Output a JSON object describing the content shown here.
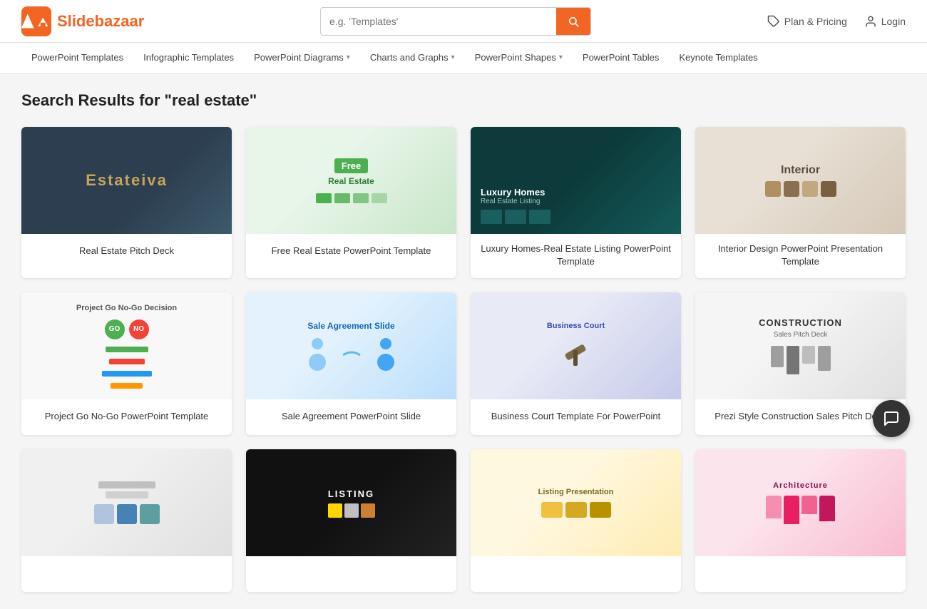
{
  "header": {
    "logo_text_slide": "Slide",
    "logo_text_bazaar": "bazaar",
    "search_placeholder": "e.g. 'Templates'",
    "search_icon": "🔍",
    "plan_pricing_label": "Plan & Pricing",
    "login_label": "Login"
  },
  "nav": {
    "items": [
      {
        "label": "PowerPoint Templates",
        "has_chevron": false
      },
      {
        "label": "Infographic Templates",
        "has_chevron": false
      },
      {
        "label": "PowerPoint Diagrams",
        "has_chevron": true
      },
      {
        "label": "Charts and Graphs",
        "has_chevron": true
      },
      {
        "label": "PowerPoint Shapes",
        "has_chevron": true
      },
      {
        "label": "PowerPoint Tables",
        "has_chevron": false
      },
      {
        "label": "Keynote Templates",
        "has_chevron": false
      }
    ]
  },
  "main": {
    "search_heading": "Search Results for \"real estate\"",
    "cards": [
      {
        "id": "card-1",
        "type": "estateiva",
        "title": "Real Estate Pitch Deck"
      },
      {
        "id": "card-2",
        "type": "free-estate",
        "title": "Free Real Estate PowerPoint Template"
      },
      {
        "id": "card-3",
        "type": "luxury",
        "title": "Luxury Homes-Real Estate Listing PowerPoint Template"
      },
      {
        "id": "card-4",
        "type": "interior",
        "title": "Interior Design PowerPoint Presentation Template"
      },
      {
        "id": "card-5",
        "type": "gono",
        "title": "Project Go No-Go PowerPoint Template"
      },
      {
        "id": "card-6",
        "type": "sale",
        "title": "Sale Agreement PowerPoint Slide"
      },
      {
        "id": "card-7",
        "type": "court",
        "title": "Business Court Template For PowerPoint"
      },
      {
        "id": "card-8",
        "type": "construction",
        "title": "Prezi Style Construction Sales Pitch Deck"
      },
      {
        "id": "card-9",
        "type": "placeholder1",
        "title": ""
      },
      {
        "id": "card-10",
        "type": "dark",
        "title": ""
      },
      {
        "id": "card-11",
        "type": "listing",
        "title": ""
      },
      {
        "id": "card-12",
        "type": "architecture",
        "title": ""
      }
    ]
  }
}
